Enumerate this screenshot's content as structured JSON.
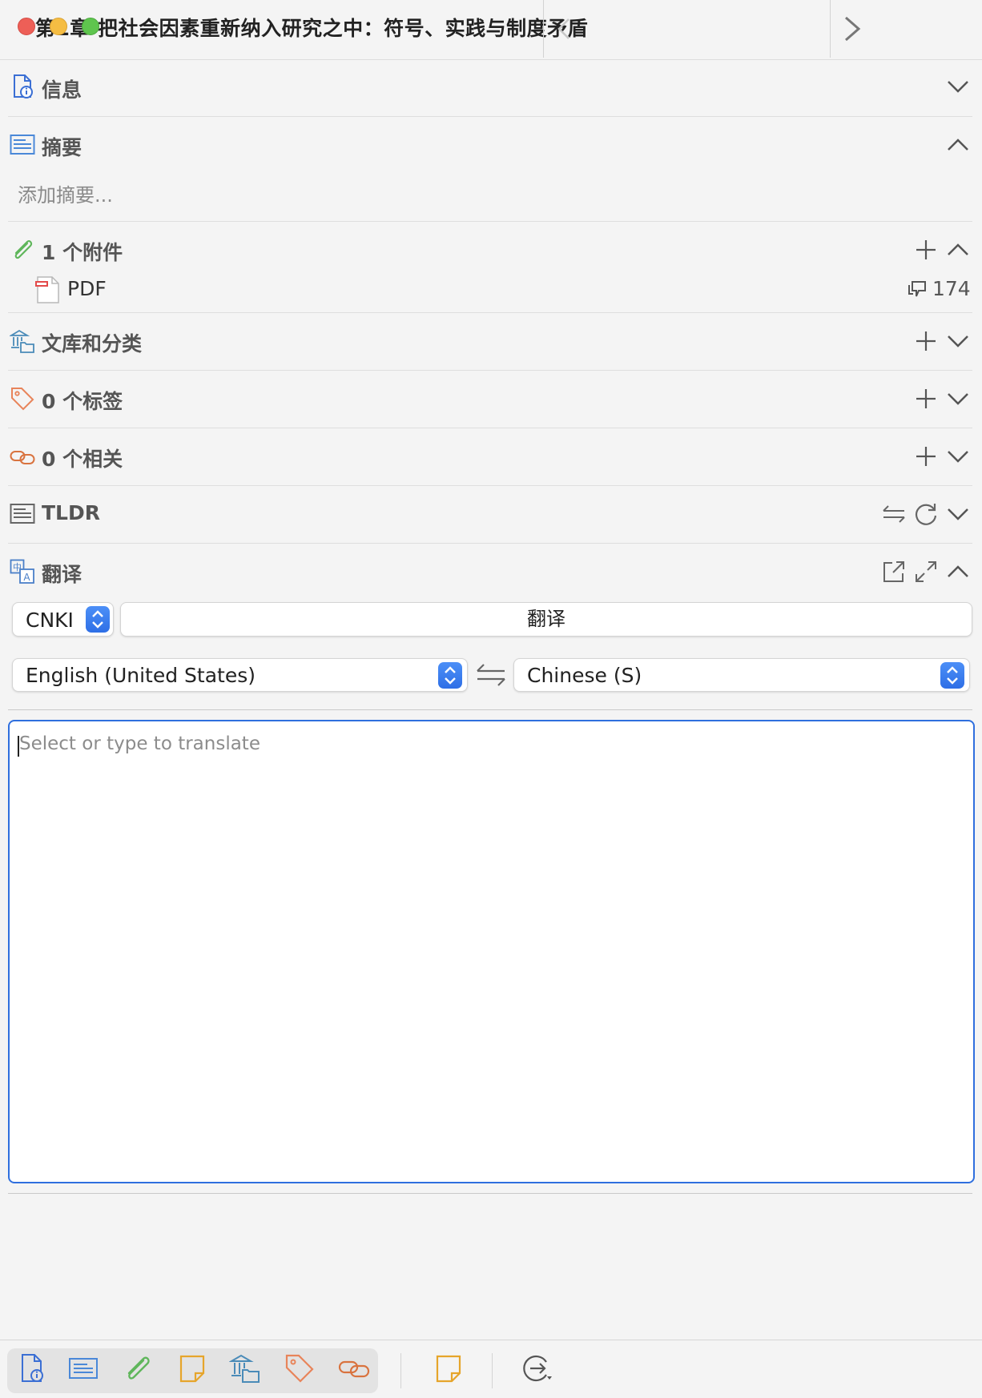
{
  "window": {
    "title": "第1章 把社会因素重新纳入研究之中：符号、实践与制度矛盾"
  },
  "sections": {
    "info": {
      "title": "信息",
      "icon": "document-info-icon",
      "state": "collapsed"
    },
    "abstract": {
      "title": "摘要",
      "icon": "abstract-icon",
      "state": "expanded",
      "placeholder": "添加摘要..."
    },
    "attachments": {
      "title": "1 个附件",
      "icon": "paperclip-icon",
      "state": "expanded",
      "items": [
        {
          "label": "PDF",
          "icon": "pdf-file-icon",
          "annotation_count": "174"
        }
      ]
    },
    "libraries": {
      "title": "文库和分类",
      "icon": "library-icon",
      "state": "collapsed"
    },
    "tags": {
      "title": "0 个标签",
      "icon": "tag-icon",
      "state": "collapsed"
    },
    "related": {
      "title": "0 个相关",
      "icon": "link-icon",
      "state": "collapsed"
    },
    "tldr": {
      "title": "TLDR",
      "icon": "tldr-icon",
      "state": "collapsed"
    },
    "translate": {
      "title": "翻译",
      "icon": "translate-icon",
      "state": "expanded",
      "engine": "CNKI",
      "translate_button": "翻译",
      "source_language": "English (United States)",
      "target_language": "Chinese (S)",
      "input_placeholder": "Select or type to translate"
    }
  },
  "bottom_bar": {
    "items": [
      "info-nav-icon",
      "abstract-nav-icon",
      "attachments-nav-icon",
      "notes-nav-icon",
      "libraries-nav-icon",
      "tags-nav-icon",
      "related-nav-icon",
      "note-add-icon",
      "locate-icon"
    ]
  },
  "colors": {
    "accent": "#2f6fde",
    "stepper": "#3b82f6",
    "attachment_green": "#5fb65b",
    "tag_orange": "#e8845a",
    "related_orange": "#d9733f",
    "note_yellow": "#e6a52b",
    "library_teal": "#4a8bb8"
  }
}
